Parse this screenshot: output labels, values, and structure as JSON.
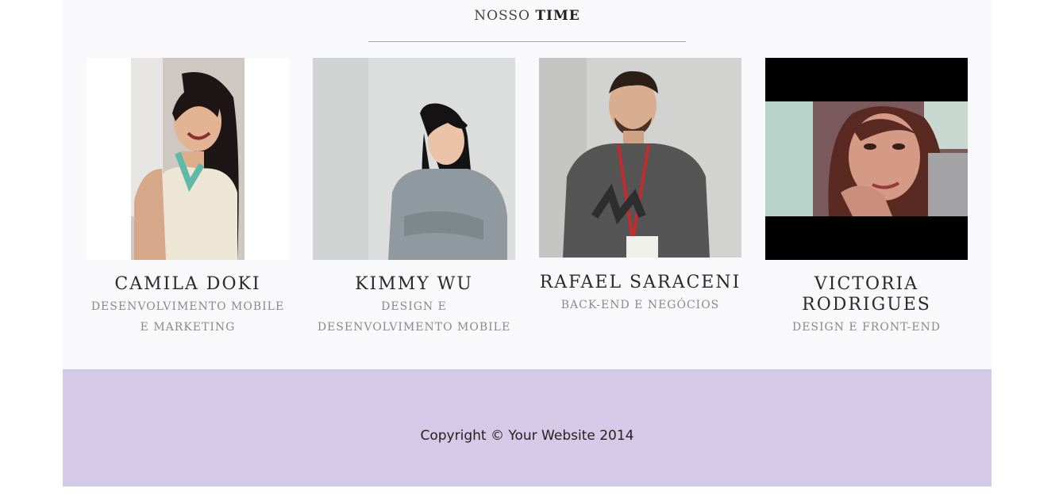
{
  "section": {
    "title_light": "NOSSO",
    "title_bold": "TIME"
  },
  "members": [
    {
      "name": "CAMILA DOKI",
      "role": "DESENVOLVIMENTO MOBILE E MARKETING"
    },
    {
      "name": "KIMMY WU",
      "role": "DESIGN E DESENVOLVIMENTO MOBILE"
    },
    {
      "name": "RAFAEL SARACENI",
      "role": "BACK-END E NEGÓCIOS"
    },
    {
      "name": "VICTORIA RODRIGUES",
      "role": "DESIGN E FRONT-END"
    }
  ],
  "footer": {
    "copyright": "Copyright © Your Website 2014"
  },
  "colors": {
    "section_bg": "#f9f9fb",
    "footer_bg": "#d4c9e6"
  }
}
